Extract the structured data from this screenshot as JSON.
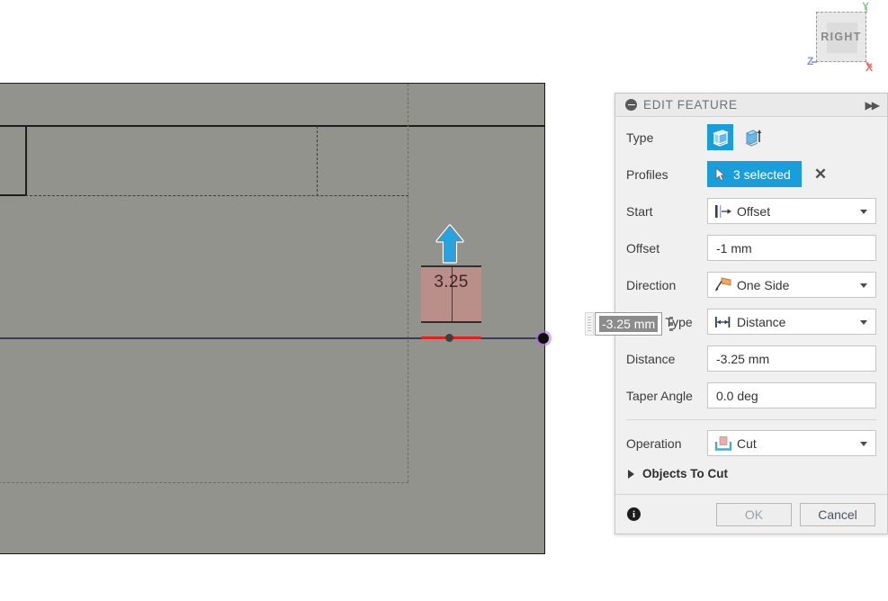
{
  "viewcube": {
    "face_label": "RIGHT",
    "axes": [
      {
        "name": "x-axis-label",
        "label": "X",
        "color": "#f06c6c"
      },
      {
        "name": "y-axis-label",
        "label": "Y",
        "color": "#7ed07e"
      },
      {
        "name": "z-axis-label",
        "label": "Z",
        "color": "#8e8ee0"
      }
    ]
  },
  "viewport": {
    "manipulator": {
      "value": "3.25",
      "arrow_icon": "up-arrow-handle",
      "box_color": "#bd8f89"
    },
    "body_color": "#91938c",
    "sketch_line_color": "#3a3b63",
    "highlight_edge_color": "#e02020"
  },
  "float_input": {
    "value": "-3.25 mm",
    "menu_icon": "kebab-menu-icon",
    "grip_icon": "drag-grip-icon"
  },
  "dialog": {
    "title": "EDIT FEATURE",
    "collapse_icon": "collapse-minus-icon",
    "expand_icon": "double-chevron-right-icon",
    "rows": {
      "type": {
        "label": "Type",
        "options": [
          {
            "name": "extrude-solid-icon",
            "selected": true
          },
          {
            "name": "extrude-thin-icon",
            "selected": false
          }
        ]
      },
      "profiles": {
        "label": "Profiles",
        "value": "3 selected",
        "cursor_icon": "selection-arrow-icon",
        "clear_label": "✕"
      },
      "start": {
        "label": "Start",
        "value": "Offset",
        "icon": "start-offset-icon"
      },
      "offset": {
        "label": "Offset",
        "value": "-1 mm"
      },
      "direction": {
        "label": "Direction",
        "value": "One Side",
        "icon": "one-side-icon"
      },
      "extent_type": {
        "label": "Extent Type",
        "value": "Distance",
        "icon": "distance-icon"
      },
      "distance": {
        "label": "Distance",
        "value": "-3.25 mm"
      },
      "taper_angle": {
        "label": "Taper Angle",
        "value": "0.0 deg"
      },
      "operation": {
        "label": "Operation",
        "value": "Cut",
        "icon": "cut-icon"
      },
      "objects_to_cut": {
        "label": "Objects To Cut",
        "expander_icon": "triangle-right-icon"
      }
    },
    "footer": {
      "info_icon": "info-icon",
      "info_glyph": "i",
      "ok_label": "OK",
      "cancel_label": "Cancel"
    }
  },
  "colors": {
    "accent_blue": "#1a9ddb",
    "panel_bg": "#f0f0f0",
    "title_text": "#6b7379"
  }
}
